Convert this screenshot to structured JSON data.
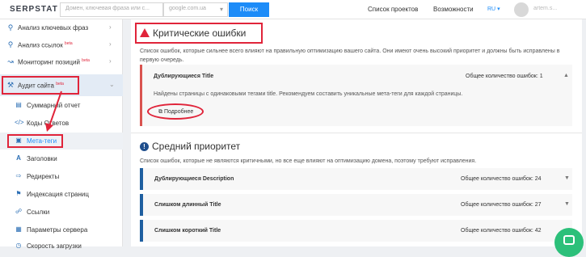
{
  "topbar": {
    "logo": "SERPSTAT",
    "search_placeholder": "Домен, ключевая фраза или с...",
    "domain_value": "google.com.ua",
    "search_button": "Поиск",
    "projects_link": "Список проектов",
    "features_link": "Возможности",
    "language": "RU",
    "user_name": "artem.s..."
  },
  "sidebar": {
    "items": [
      {
        "label": "Анализ ключевых фраз",
        "badge": "",
        "icon": "search-icon"
      },
      {
        "label": "Анализ ссылок",
        "badge": "beta",
        "icon": "search-icon"
      },
      {
        "label": "Мониторинг позиций",
        "badge": "beta",
        "icon": "chart-icon"
      },
      {
        "label": "Аудит сайта",
        "badge": "beta",
        "icon": "wrench-icon"
      }
    ],
    "subitems": [
      {
        "label": "Суммарный отчет",
        "icon": "report-icon"
      },
      {
        "label": "Коды Ответов",
        "icon": "code-icon"
      },
      {
        "label": "Мета-теги",
        "icon": "file-icon"
      },
      {
        "label": "Заголовки",
        "icon": "heading-icon"
      },
      {
        "label": "Редиректы",
        "icon": "redirect-icon"
      },
      {
        "label": "Индексация страниц",
        "icon": "index-icon"
      },
      {
        "label": "Ссылки",
        "icon": "link-icon"
      },
      {
        "label": "Параметры сервера",
        "icon": "server-icon"
      },
      {
        "label": "Скорость загрузки",
        "icon": "speed-icon"
      }
    ]
  },
  "critical": {
    "title": "Критические ошибки",
    "description": "Список ошибок, которые сильнее всего влияют на правильную оптимизацию вашего сайта. Они имеют очень высокий приоритет и должны быть исправлены в первую очередь.",
    "card": {
      "name": "Дублирующиеся Title",
      "count_label": "Общее количество ошибок: 1",
      "body": "Найдены страницы с одинаковыми тегами title. Рекомендуем составить уникальные мета-теги для каждой страницы.",
      "more": "Подробнее"
    }
  },
  "medium": {
    "title": "Средний приоритет",
    "description": "Список ошибок, которые не являются критичными, но все еще влияют на оптимизацию домена, поэтому требуют исправления.",
    "cards": [
      {
        "name": "Дублирующиеся Description",
        "count_label": "Общее количество ошибок: 24"
      },
      {
        "name": "Слишком длинный Title",
        "count_label": "Общее количество ошибок: 27"
      },
      {
        "name": "Слишком короткий Title",
        "count_label": "Общее количество ошибок: 42"
      }
    ]
  },
  "colors": {
    "accent_blue": "#1d8cf8",
    "annotation_red": "#e0243a",
    "chat_green": "#2cc07a"
  }
}
